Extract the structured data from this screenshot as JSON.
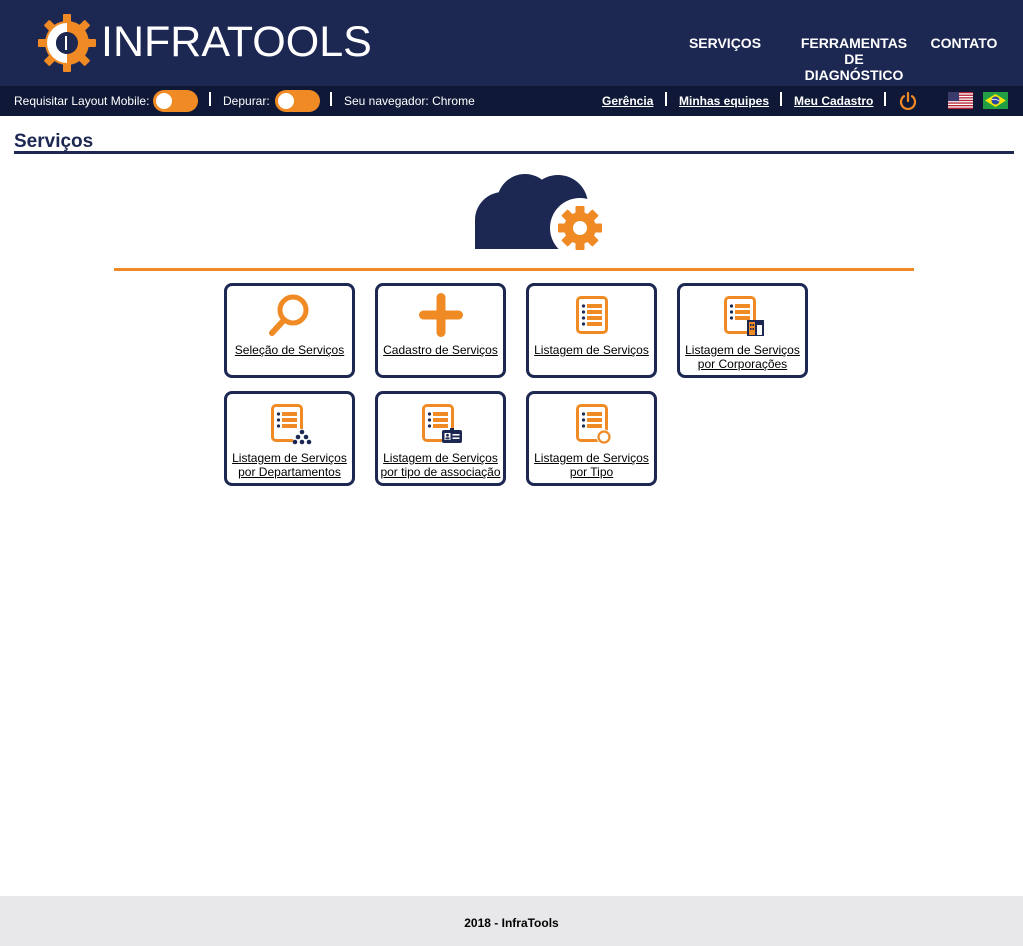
{
  "brand": {
    "name": "INFRATOOLS"
  },
  "nav": {
    "items": [
      {
        "label": "SERVIÇOS"
      },
      {
        "label": "FERRAMENTAS DE DIAGNÓSTICO",
        "lines": [
          "FERRAMENTAS",
          "DE",
          "DIAGNÓSTICO"
        ]
      },
      {
        "label": "CONTATO"
      }
    ]
  },
  "toolbar": {
    "mobile_label": "Requisitar Layout Mobile:",
    "debug_label": "Depurar:",
    "browser_label": "Seu navegador: Chrome",
    "links": [
      {
        "label": "Gerência"
      },
      {
        "label": "Minhas equipes"
      },
      {
        "label": "Meu Cadastro"
      }
    ]
  },
  "page": {
    "title": "Serviços"
  },
  "tiles": [
    {
      "lines": [
        "Seleção de Serviços"
      ],
      "icon": "search-icon"
    },
    {
      "lines": [
        "Cadastro de Serviços"
      ],
      "icon": "plus-icon"
    },
    {
      "lines": [
        "Listagem de Serviços"
      ],
      "icon": "list-icon"
    },
    {
      "lines": [
        "Listagem de Serviços",
        "por Corporações"
      ],
      "icon": "list-building-icon"
    },
    {
      "lines": [
        "Listagem de Serviços",
        "por Departamentos"
      ],
      "icon": "list-hierarchy-icon"
    },
    {
      "lines": [
        "Listagem de Serviços",
        "por tipo de associação"
      ],
      "icon": "list-id-card-icon"
    },
    {
      "lines": [
        "Listagem de Serviços",
        "por Tipo"
      ],
      "icon": "list-circle-icon"
    }
  ],
  "colors": {
    "navy": "#1c2752",
    "orange": "#f08a24",
    "toolbar": "#0f1937"
  },
  "footer": {
    "text": "2018 - InfraTools"
  }
}
